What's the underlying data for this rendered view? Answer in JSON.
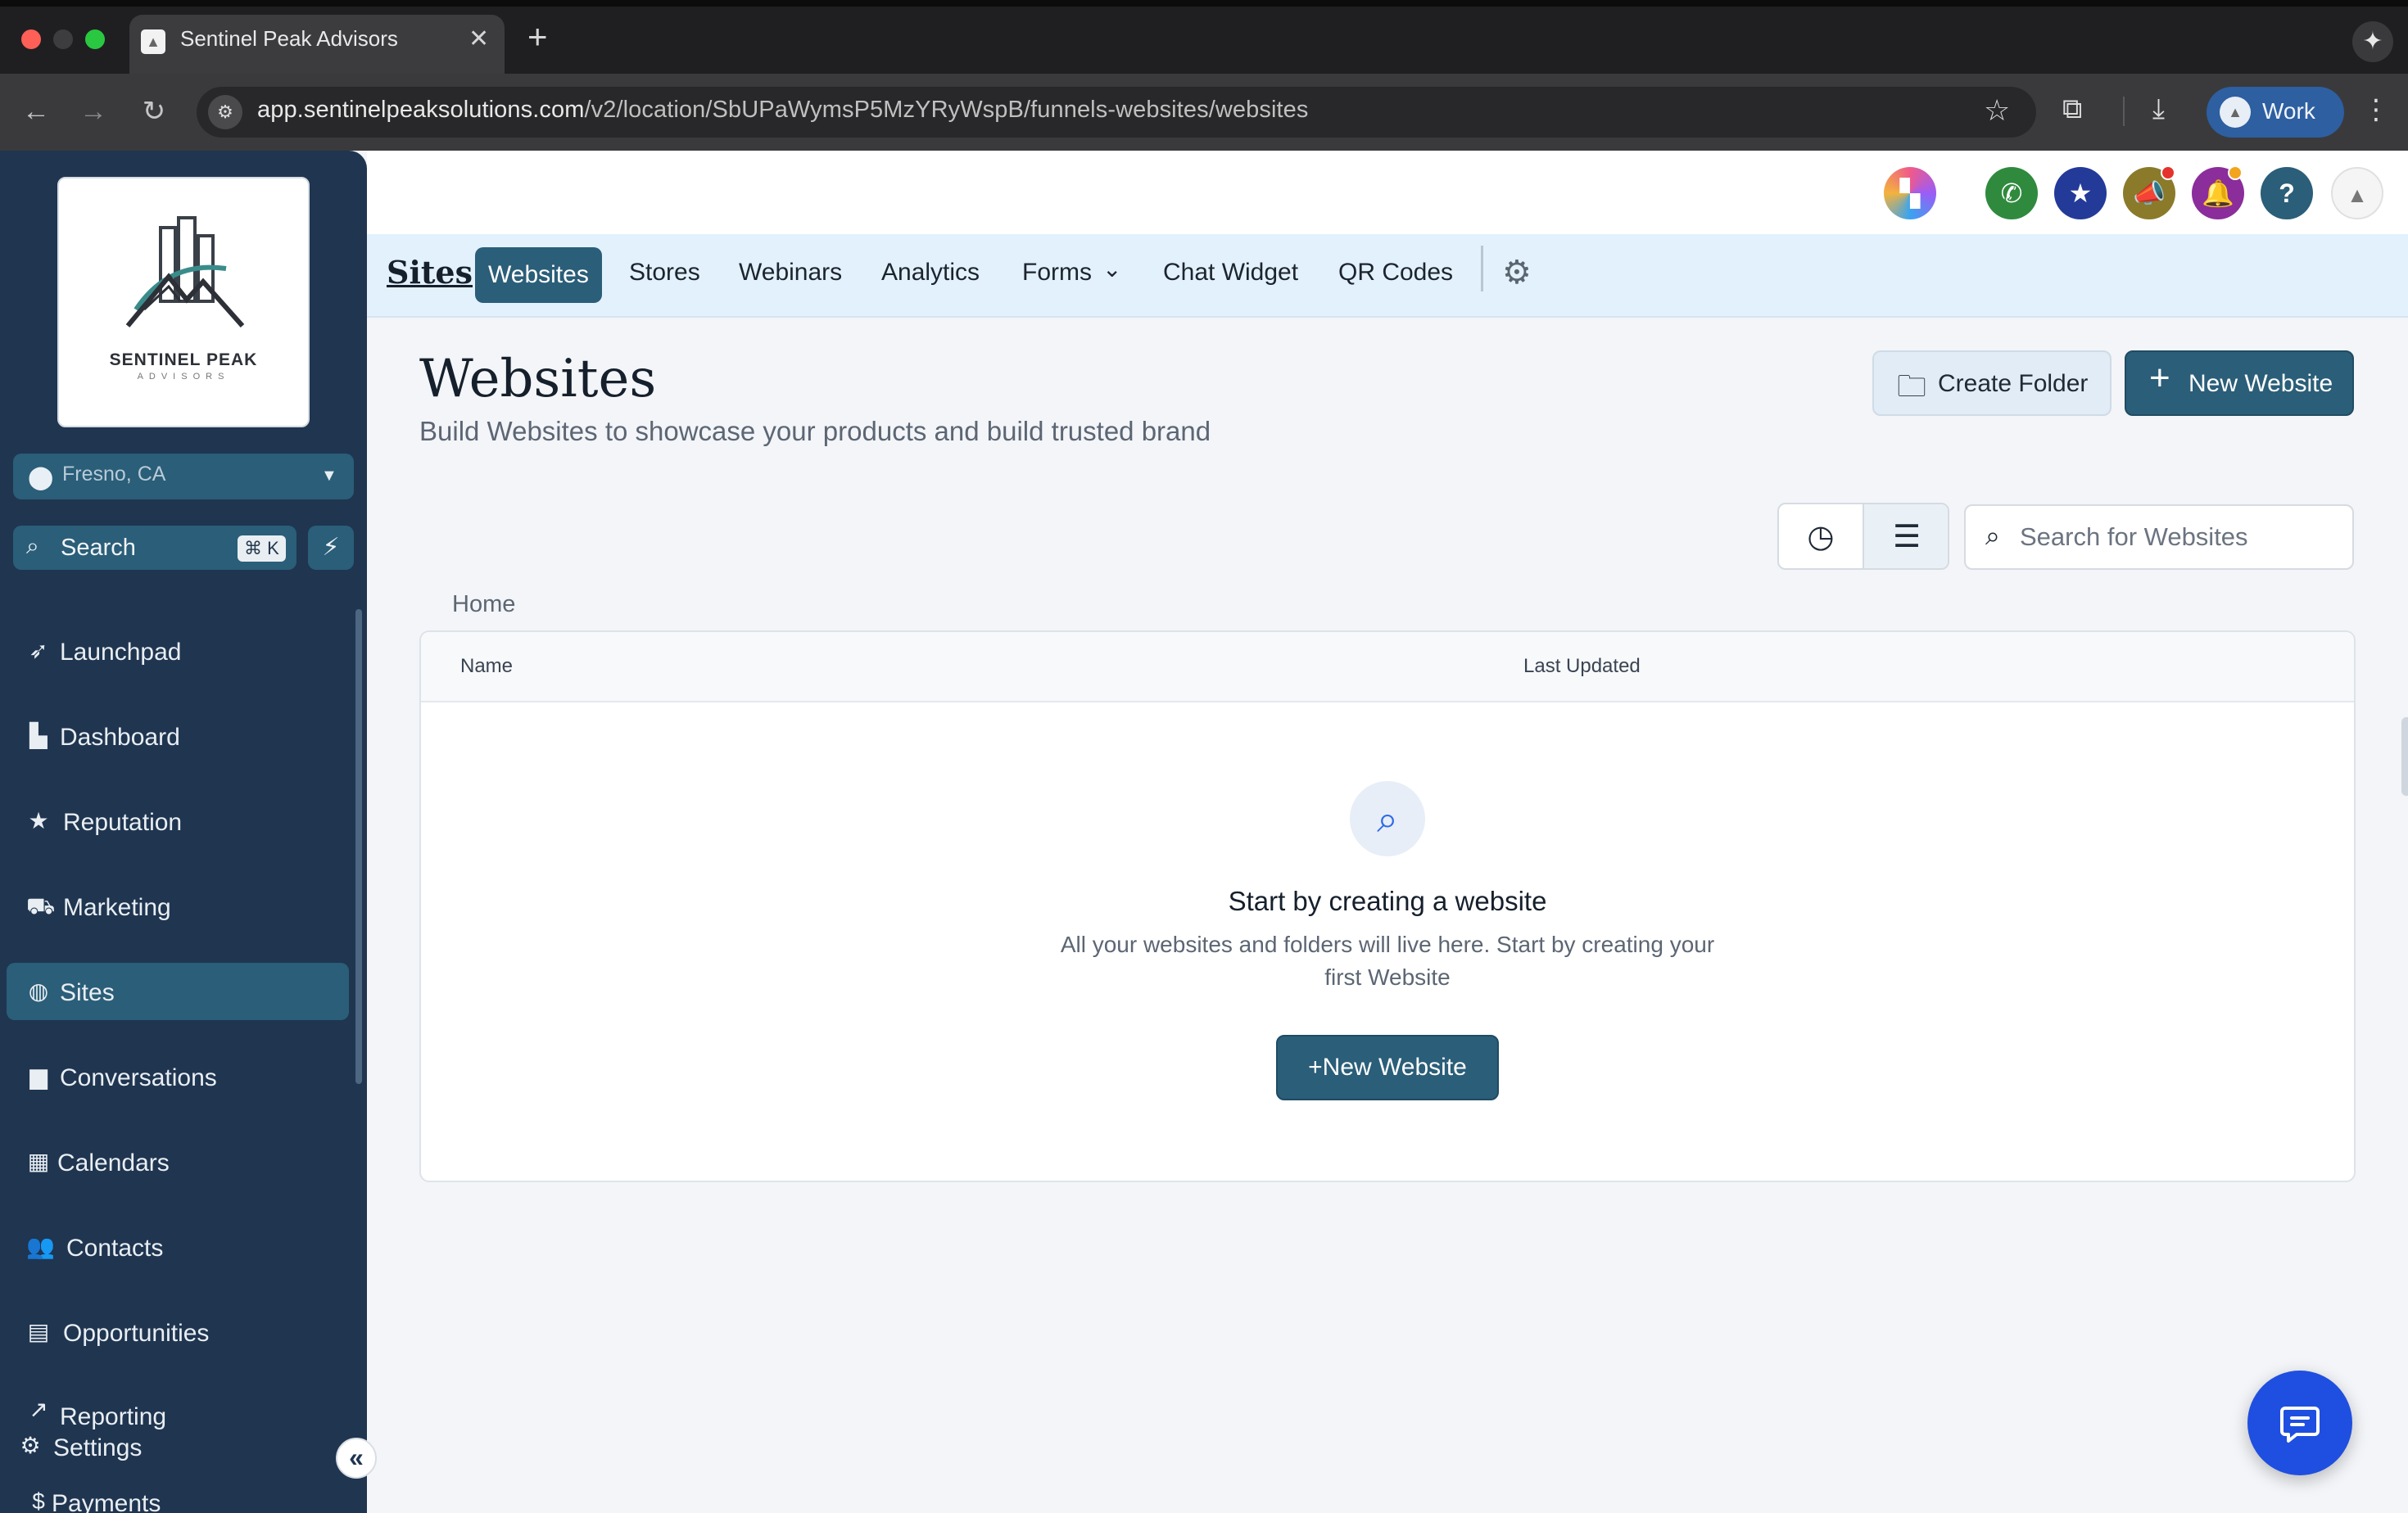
{
  "browser": {
    "tab_title": "Sentinel Peak Advisors",
    "url_domain": "app.sentinelpeaksolutions.com",
    "url_path": "/v2/location/SbUPaWymsP5MzYRyWspB/funnels-websites/websites",
    "profile_label": "Work"
  },
  "sidebar": {
    "logo_name": "SENTINEL PEAK",
    "logo_sub": "ADVISORS",
    "location": "Fresno, CA",
    "search_label": "Search",
    "search_shortcut": "⌘ K",
    "items": [
      {
        "label": "Launchpad",
        "icon": "rocket-icon"
      },
      {
        "label": "Dashboard",
        "icon": "chart-icon"
      },
      {
        "label": "Reputation",
        "icon": "star-icon"
      },
      {
        "label": "Marketing",
        "icon": "cart-icon"
      },
      {
        "label": "Sites",
        "icon": "globe-icon",
        "active": true
      },
      {
        "label": "Conversations",
        "icon": "chat-icon"
      },
      {
        "label": "Calendars",
        "icon": "calendar-icon"
      },
      {
        "label": "Contacts",
        "icon": "contacts-icon"
      },
      {
        "label": "Opportunities",
        "icon": "money-icon"
      },
      {
        "label": "Reporting",
        "icon": "trend-icon"
      },
      {
        "label": "Settings",
        "icon": "gear-icon"
      },
      {
        "label": "Payments",
        "icon": "payments-icon"
      }
    ]
  },
  "subnav": {
    "title": "Sites",
    "tabs": [
      "Websites",
      "Stores",
      "Webinars",
      "Analytics",
      "Forms",
      "Chat Widget",
      "QR Codes"
    ],
    "active_tab": "Websites"
  },
  "page": {
    "title": "Websites",
    "subtitle": "Build Websites to showcase your products and build trusted brand",
    "create_folder_label": "Create Folder",
    "new_website_label": "New Website",
    "search_placeholder": "Search for Websites",
    "breadcrumb": "Home"
  },
  "table": {
    "columns": [
      "Name",
      "Last Updated"
    ],
    "rows": []
  },
  "empty_state": {
    "title": "Start by creating a website",
    "description": "All your websites and folders will live here. Start by creating your first Website",
    "button_label": "New Website"
  },
  "colors": {
    "sidebar_bg": "#1f3550",
    "accent": "#2b5e78",
    "subnav_bg": "#e2f1fb",
    "chat_fab": "#1f4fe0"
  }
}
